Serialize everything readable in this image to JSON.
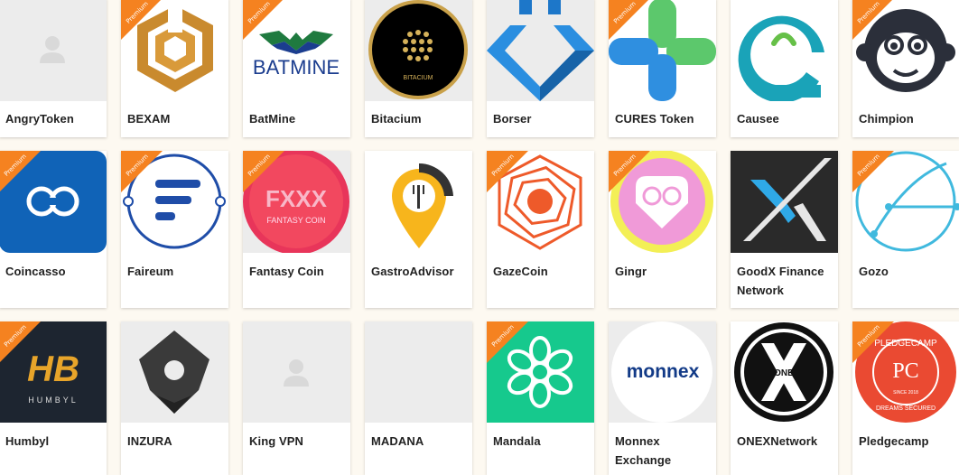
{
  "ribbon_label": "Premium",
  "accent_color": "#f58220",
  "rows": [
    [
      {
        "name": "AngryToken",
        "premium": false,
        "icon": "placeholder-user-icon"
      },
      {
        "name": "BEXAM",
        "premium": true,
        "icon": "bexam-logo-icon"
      },
      {
        "name": "BatMine",
        "premium": true,
        "icon": "batmine-logo-icon",
        "logo_text": "BATMINE"
      },
      {
        "name": "Bitacium",
        "premium": false,
        "icon": "bitacium-logo-icon",
        "logo_text": "BITACIUM"
      },
      {
        "name": "Borser",
        "premium": false,
        "icon": "borser-logo-icon"
      },
      {
        "name": "CURES Token",
        "premium": true,
        "icon": "cures-cross-icon"
      },
      {
        "name": "Causee",
        "premium": false,
        "icon": "causee-logo-icon"
      },
      {
        "name": "Chimpion",
        "premium": true,
        "icon": "chimpion-monkey-icon"
      }
    ],
    [
      {
        "name": "Coincasso",
        "premium": true,
        "icon": "coincasso-logo-icon"
      },
      {
        "name": "Faireum",
        "premium": true,
        "icon": "faireum-logo-icon"
      },
      {
        "name": "Fantasy Coin",
        "premium": true,
        "icon": "fantasy-coin-logo-icon",
        "logo_text": "FXXX",
        "logo_subtext": "FANTASY COIN"
      },
      {
        "name": "GastroAdvisor",
        "premium": false,
        "icon": "gastroadvisor-logo-icon"
      },
      {
        "name": "GazeCoin",
        "premium": true,
        "icon": "gazecoin-spiral-icon"
      },
      {
        "name": "Gingr",
        "premium": true,
        "icon": "gingr-logo-icon"
      },
      {
        "name": "GoodX Finance Network",
        "premium": false,
        "icon": "goodx-logo-icon"
      },
      {
        "name": "Gozo",
        "premium": true,
        "icon": "gozo-logo-icon"
      }
    ],
    [
      {
        "name": "Humbyl",
        "premium": true,
        "icon": "humbyl-logo-icon",
        "logo_text": "HB",
        "logo_subtext": "HUMBYL"
      },
      {
        "name": "INZURA",
        "premium": false,
        "icon": "inzura-logo-icon"
      },
      {
        "name": "King VPN",
        "premium": false,
        "icon": "placeholder-user-icon"
      },
      {
        "name": "MADANA",
        "premium": false,
        "icon": "blank-logo-icon"
      },
      {
        "name": "Mandala",
        "premium": true,
        "icon": "mandala-flower-icon"
      },
      {
        "name": "Monnex Exchange",
        "premium": false,
        "icon": "monnex-logo-icon",
        "logo_text": "monnex"
      },
      {
        "name": "ONEXNetwork",
        "premium": false,
        "icon": "onex-logo-icon",
        "logo_text": "ONE"
      },
      {
        "name": "Pledgecamp",
        "premium": true,
        "icon": "pledgecamp-logo-icon",
        "logo_text": "PLEDGECAMP",
        "logo_subtext": "DREAMS SECURED",
        "logo_small": "SINCE 2018"
      }
    ]
  ]
}
